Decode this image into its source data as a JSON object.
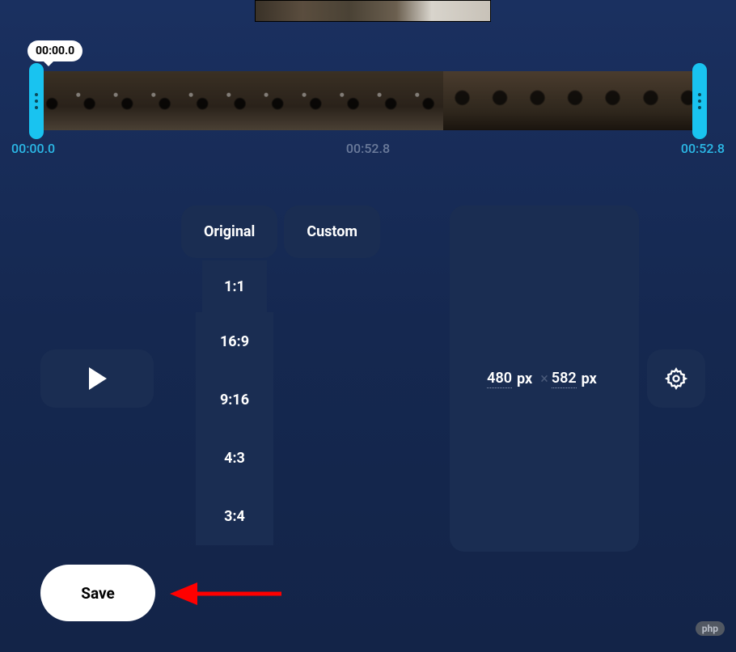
{
  "preview": {
    "exists": true
  },
  "timeline": {
    "tooltip": "00:00.0",
    "start_label": "00:00.0",
    "mid_label": "00:52.8",
    "end_label": "00:52.8",
    "thumb_count": 18
  },
  "tabs": {
    "original": "Original",
    "custom": "Custom"
  },
  "ratios": [
    "1:1",
    "16:9",
    "9:16",
    "4:3",
    "3:4"
  ],
  "dimensions": {
    "width": "480",
    "width_unit": "px",
    "sep": "×",
    "height": "582",
    "height_unit": "px"
  },
  "buttons": {
    "save": "Save"
  },
  "watermark": {
    "badge": "php",
    "text": ""
  }
}
